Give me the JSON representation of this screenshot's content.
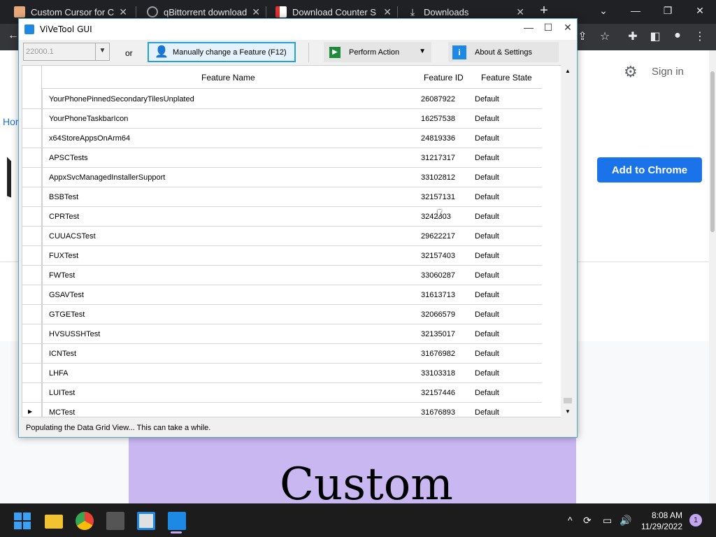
{
  "browser": {
    "tabs": [
      {
        "title": "Custom Cursor for Chro",
        "icon": "custom-cursor-favicon",
        "color": "#e8a87c"
      },
      {
        "title": "qBittorrent download l",
        "icon": "search-favicon",
        "color": "#9aa0a6"
      },
      {
        "title": "Download Counter Stri",
        "icon": "cs-favicon",
        "color": "#d33"
      },
      {
        "title": "Downloads",
        "icon": "download-icon",
        "color": "#e8eaed"
      }
    ],
    "newtab": "+",
    "signin": "Sign in",
    "add_button": "Add to Chrome",
    "breadcrumb": "Hor",
    "banner_text": "Custom"
  },
  "vivetool": {
    "title": "ViVeTool GUI",
    "build": "22000.1",
    "or_text": "or",
    "manual_button": "Manually change a Feature (F12)",
    "perform_button": "Perform Action",
    "about_button": "About & Settings",
    "columns": [
      "Feature Name",
      "Feature ID",
      "Feature State"
    ],
    "rows": [
      {
        "name": "YourPhonePinnedSecondaryTilesUnplated",
        "id": "26087922",
        "state": "Default"
      },
      {
        "name": "YourPhoneTaskbarIcon",
        "id": "16257538",
        "state": "Default"
      },
      {
        "name": "x64StoreAppsOnArm64",
        "id": "24819336",
        "state": "Default"
      },
      {
        "name": "APSCTests",
        "id": "31217317",
        "state": "Default"
      },
      {
        "name": "AppxSvcManagedInstallerSupport",
        "id": "33102812",
        "state": "Default"
      },
      {
        "name": "BSBTest",
        "id": "32157131",
        "state": "Default"
      },
      {
        "name": "CPRTest",
        "id": "3242​803",
        "state": "Default"
      },
      {
        "name": "CUUACSTest",
        "id": "29622217",
        "state": "Default"
      },
      {
        "name": "FUXTest",
        "id": "32157403",
        "state": "Default"
      },
      {
        "name": "FWTest",
        "id": "33060287",
        "state": "Default"
      },
      {
        "name": "GSAVTest",
        "id": "31613713",
        "state": "Default"
      },
      {
        "name": "GTGETest",
        "id": "32066579",
        "state": "Default"
      },
      {
        "name": "HVSUSSHTest",
        "id": "32135017",
        "state": "Default"
      },
      {
        "name": "ICNTest",
        "id": "31676982",
        "state": "Default"
      },
      {
        "name": "LHFA",
        "id": "33103318",
        "state": "Default"
      },
      {
        "name": "LUITest",
        "id": "32157446",
        "state": "Default"
      },
      {
        "name": "MCTest",
        "id": "31676893",
        "state": "Default",
        "current": true
      }
    ],
    "status": "Populating the Data Grid View... This can take a while."
  },
  "taskbar": {
    "time": "8:08 AM",
    "date": "11/29/2022",
    "notifications": "1"
  }
}
